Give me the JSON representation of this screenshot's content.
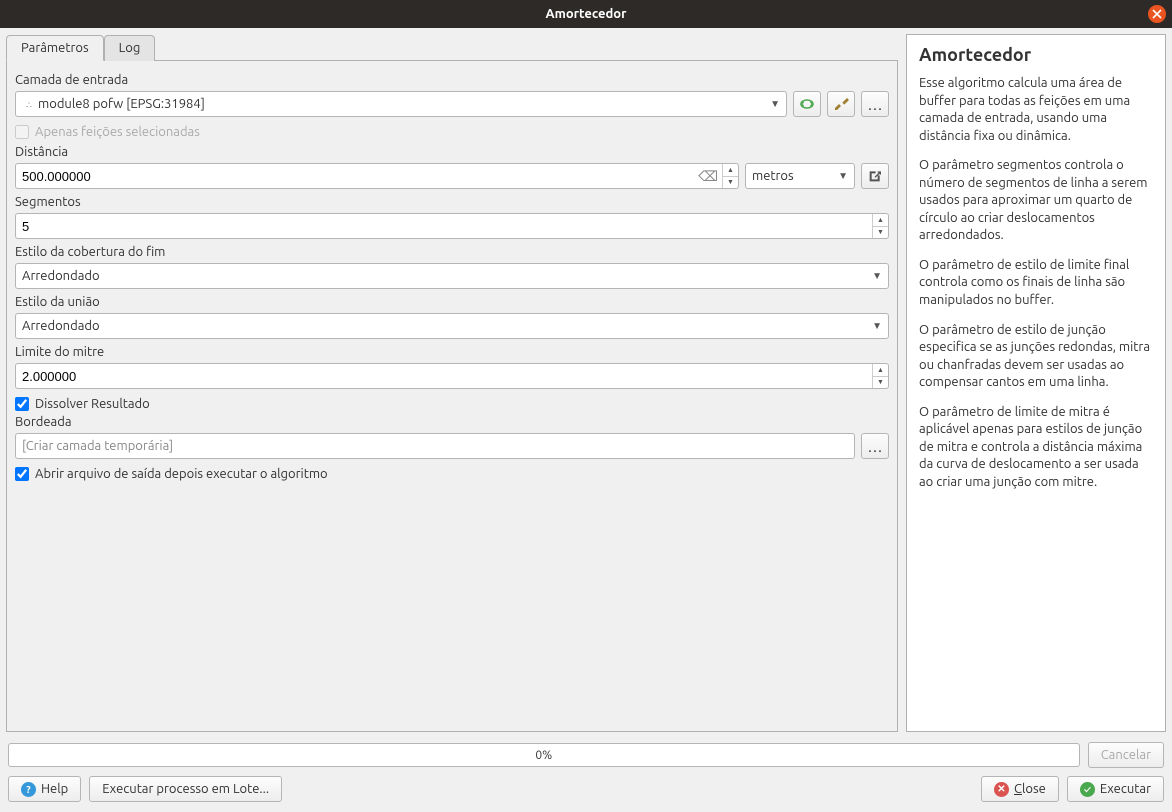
{
  "titlebar": {
    "title": "Amortecedor"
  },
  "tabs": {
    "parameters": "Parâmetros",
    "log": "Log"
  },
  "labels": {
    "input_layer": "Camada de entrada",
    "selected_only": "Apenas feições selecionadas",
    "distance": "Distância",
    "segments": "Segmentos",
    "end_cap": "Estilo da cobertura do fim",
    "join_style": "Estilo da união",
    "miter_limit": "Limite do mitre",
    "dissolve": "Dissolver Resultado",
    "bordered": "Bordeada",
    "output_placeholder": "[Criar camada temporária]",
    "open_after": "Abrir arquivo de saída depois executar o algoritmo"
  },
  "values": {
    "input_layer": "module8 pofw [EPSG:31984]",
    "distance": "500.000000",
    "distance_unit": "metros",
    "segments": "5",
    "end_cap": "Arredondado",
    "join_style": "Arredondado",
    "miter_limit": "2.000000",
    "dissolve_checked": true,
    "open_after_checked": true
  },
  "help": {
    "title": "Amortecedor",
    "p1": "Esse algoritmo calcula uma área de buffer para todas as feições em uma camada de entrada, usando uma distância fixa ou dinâmica.",
    "p2": "O parâmetro segmentos controla o número de segmentos de linha a serem usados para aproximar um quarto de círculo ao criar deslocamentos arredondados.",
    "p3": "O parâmetro de estilo de limite final controla como os finais de linha são manipulados no buffer.",
    "p4": "O parâmetro de estilo de junção especifica se as junções redondas, mitra ou chanfradas devem ser usadas ao compensar cantos em uma linha.",
    "p5": "O parâmetro de limite de mitra é aplicável apenas para estilos de junção de mitra e controla a distância máxima da curva de deslocamento a ser usada ao criar uma junção com mitre."
  },
  "progress": {
    "text": "0%"
  },
  "buttons": {
    "cancel": "Cancelar",
    "help": "Help",
    "batch": "Executar processo em Lote...",
    "close": "Close",
    "run": "Executar"
  }
}
